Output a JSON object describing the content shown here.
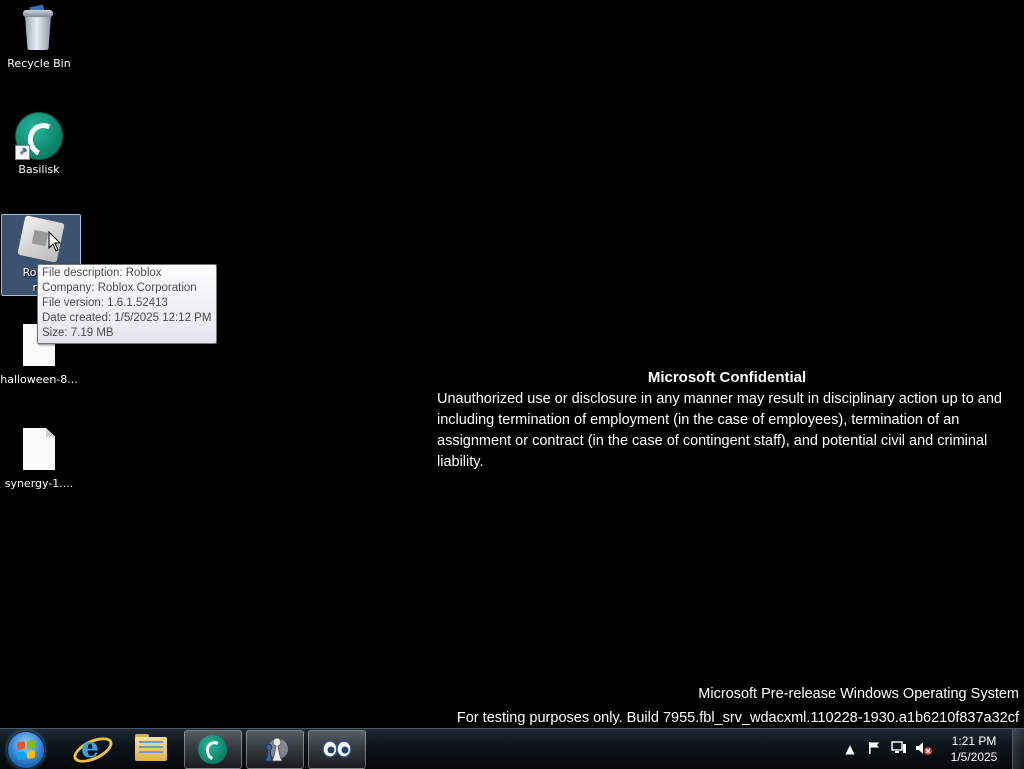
{
  "desktop": {
    "icons": [
      {
        "label": "Recycle Bin",
        "icon": "recycle-bin-icon"
      },
      {
        "label": "Basilisk",
        "icon": "basilisk-icon"
      },
      {
        "label": "RobloxPlayerInstaller",
        "label_line1": "Roblox",
        "label_line2": "nst",
        "icon": "roblox-installer-icon"
      },
      {
        "label": "halloween-8...",
        "icon": "blank-file-icon"
      },
      {
        "label": "synergy-1....",
        "icon": "blank-file-icon"
      }
    ],
    "tooltip": {
      "lines": [
        "File description: Roblox",
        "Company: Roblox Corporation",
        "File version: 1.6.1.52413",
        "Date created: 1/5/2025 12:12 PM",
        "Size: 7.19 MB"
      ]
    }
  },
  "watermark": {
    "title": "Microsoft Confidential",
    "body": "Unauthorized use or disclosure in any manner may result in disciplinary action up to and including termination of employment (in the case of employees), termination of an assignment or contract (in the case of contingent staff), and potential civil and criminal liability.",
    "os_name": "Microsoft Pre-release Windows Operating System",
    "build_line": "For testing purposes only. Build 7955.fbl_srv_wdacxml.110228-1930.a1b6210f837a32cf"
  },
  "taskbar": {
    "start": {
      "icon": "windows-start-orb-icon"
    },
    "pinned": [
      {
        "name": "Internet Explorer",
        "icon": "internet-explorer-icon",
        "running": false
      },
      {
        "name": "Windows Explorer",
        "icon": "folder-icon",
        "running": false
      },
      {
        "name": "Basilisk",
        "icon": "basilisk-icon",
        "running": true
      },
      {
        "name": "Chess",
        "icon": "chess-icon",
        "running": true
      },
      {
        "name": "Eyes",
        "icon": "eyes-icon",
        "running": true
      }
    ],
    "tray": {
      "icons": [
        "show-hidden-icons-arrow",
        "action-center-flag-icon",
        "network-icon",
        "volume-muted-icon"
      ],
      "time": "1:21 PM",
      "date": "1/5/2025"
    }
  },
  "colors": {
    "desktop_bg": "#000000",
    "selection": "#6e96c8",
    "basilisk_green": "#0b7f66"
  }
}
